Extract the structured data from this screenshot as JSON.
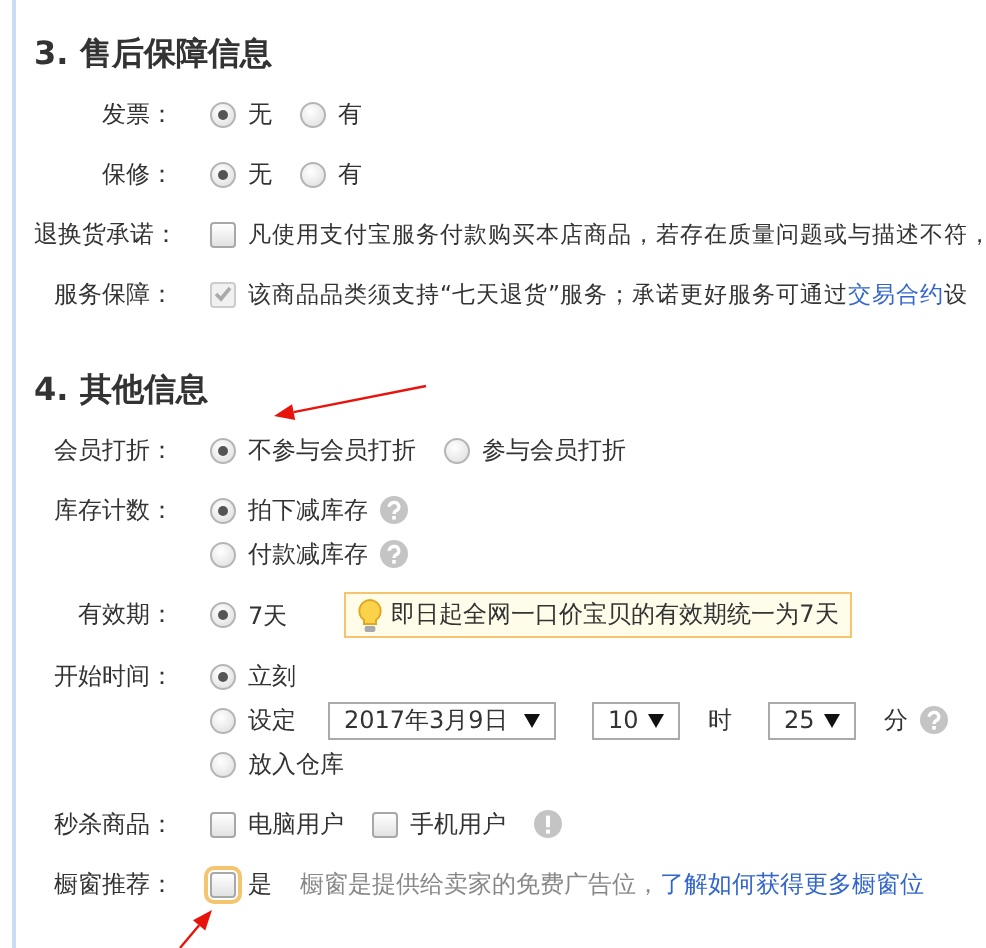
{
  "sections": [
    {
      "title": "3. 售后保障信息",
      "rows": [
        {
          "label": "发票：",
          "kind": "radio",
          "options": [
            {
              "label": "无",
              "selected": true
            },
            {
              "label": "有",
              "selected": false
            }
          ]
        },
        {
          "label": "保修：",
          "kind": "radio",
          "options": [
            {
              "label": "无",
              "selected": true
            },
            {
              "label": "有",
              "selected": false
            }
          ]
        },
        {
          "label": "退换货承诺：",
          "kind": "checkbox",
          "options": [
            {
              "label": "凡使用支付宝服务付款购买本店商品，若存在质量问题或与描述不符，",
              "checked": false
            }
          ]
        },
        {
          "label": "服务保障：",
          "kind": "checkbox",
          "options": [
            {
              "label": "该商品品类须支持“七天退货”服务；承诺更好服务可通过",
              "link": "交易合约",
              "label_after": "设",
              "checked": true,
              "disabled": true
            }
          ]
        }
      ]
    },
    {
      "title": "4. 其他信息",
      "rows": [
        {
          "label": "会员打折：",
          "kind": "radio",
          "options": [
            {
              "label": "不参与会员打折",
              "selected": true
            },
            {
              "label": "参与会员打折",
              "selected": false
            }
          ]
        },
        {
          "label": "库存计数：",
          "kind": "radio-stack",
          "options": [
            {
              "label": "拍下减库存",
              "selected": true,
              "help": true
            },
            {
              "label": "付款减库存",
              "selected": false,
              "help": true
            }
          ]
        },
        {
          "label": "有效期：",
          "kind": "radio",
          "options": [
            {
              "label": "7天",
              "selected": true
            }
          ],
          "tip": "即日起全网一口价宝贝的有效期统一为7天"
        },
        {
          "label": "开始时间：",
          "kind": "radio-stack",
          "options": [
            {
              "label": "立刻",
              "selected": true
            },
            {
              "label": "设定",
              "selected": false,
              "help": true,
              "selects": [
                {
                  "value": "2017年3月9日"
                },
                {
                  "value": "10",
                  "unit": "时"
                },
                {
                  "value": "25",
                  "unit": "分"
                }
              ]
            },
            {
              "label": "放入仓库",
              "selected": false
            }
          ]
        },
        {
          "label": "秒杀商品：",
          "kind": "checkbox",
          "info": true,
          "options": [
            {
              "label": "电脑用户",
              "checked": false
            },
            {
              "label": "手机用户",
              "checked": false
            }
          ]
        },
        {
          "label": "橱窗推荐：",
          "kind": "checkbox",
          "options": [
            {
              "label": "是",
              "checked": false,
              "focused": true
            }
          ],
          "hint": "橱窗是提供给卖家的免费广告位，",
          "link": "了解如何获得更多橱窗位"
        }
      ]
    }
  ],
  "annotations": [
    {
      "kind": "arrow"
    },
    {
      "kind": "arrow"
    }
  ]
}
